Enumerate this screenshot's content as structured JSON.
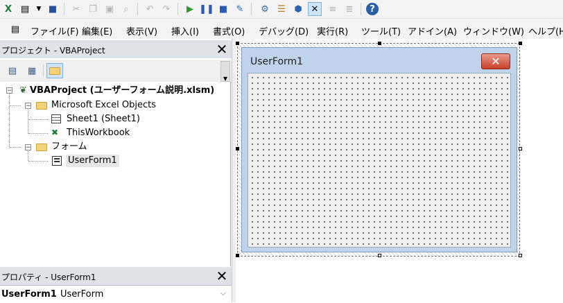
{
  "menus": [
    {
      "label": "ファイル(F)"
    },
    {
      "label": "編集(E)"
    },
    {
      "label": "表示(V)"
    },
    {
      "label": "挿入(I)"
    },
    {
      "label": "書式(O)"
    },
    {
      "label": "デバッグ(D)"
    },
    {
      "label": "実行(R)"
    },
    {
      "label": "ツール(T)"
    },
    {
      "label": "アドイン(A)"
    },
    {
      "label": "ウィンドウ(W)"
    },
    {
      "label": "ヘルプ(H"
    }
  ],
  "toolbar_icons": [
    "excel-view-icon",
    "insert-form-icon",
    "dropdown-arrow-icon",
    "save-icon",
    "cut-icon",
    "copy-icon",
    "paste-icon",
    "find-icon",
    "undo-icon",
    "redo-icon",
    "run-icon",
    "break-icon",
    "reset-icon",
    "design-mode-icon",
    "project-explorer-icon",
    "properties-window-icon",
    "object-browser-icon",
    "toolbox-icon",
    "tab-order-icon",
    "align-icon",
    "help-icon"
  ],
  "project_pane": {
    "title": "プロジェクト - VBAProject",
    "close": "✕",
    "tree": {
      "root": "VBAProject (ユーザーフォーム説明.xlsm)",
      "folder1": "Microsoft Excel Objects",
      "sheet1": "Sheet1 (Sheet1)",
      "workbook": "ThisWorkbook",
      "folder2": "フォーム",
      "userform": "UserForm1"
    }
  },
  "props_pane": {
    "title": "プロパティ - UserForm1",
    "close": "✕",
    "object_name": "UserForm1",
    "object_type": "UserForm"
  },
  "form": {
    "caption": "UserForm1",
    "close": "✕"
  },
  "colors": {
    "form_caption_bg": "#bfd4ea",
    "close_button": "#c9402a",
    "pane_title_bg": "#dfe3e8"
  }
}
